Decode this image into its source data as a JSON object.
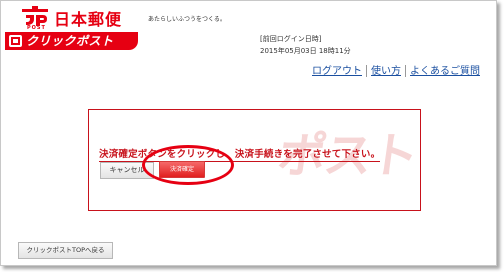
{
  "header": {
    "brand_title": "日本郵便",
    "post_label": "POST",
    "tagline": "あたらしいふつうをつくる。",
    "service_logo_text": "クリックポスト"
  },
  "last_login": {
    "label": "[前回ログイン日時]",
    "value": "2015年05月03日 18時11分"
  },
  "nav": {
    "logout": "ログアウト",
    "how_to": "使い方",
    "faq": "よくあるご質問"
  },
  "panel": {
    "instruction": "決済確定ボタンをクリックし、決済手続きを完了させて下さい。",
    "watermark": "ポスト",
    "cancel_label": "キャンセル",
    "confirm_label": "決済確定"
  },
  "footer": {
    "back_label": "クリックポストTOPへ戻る"
  },
  "colors": {
    "brand_red": "#e60012",
    "link_blue": "#1a4fa0",
    "panel_border": "#c8121b"
  }
}
